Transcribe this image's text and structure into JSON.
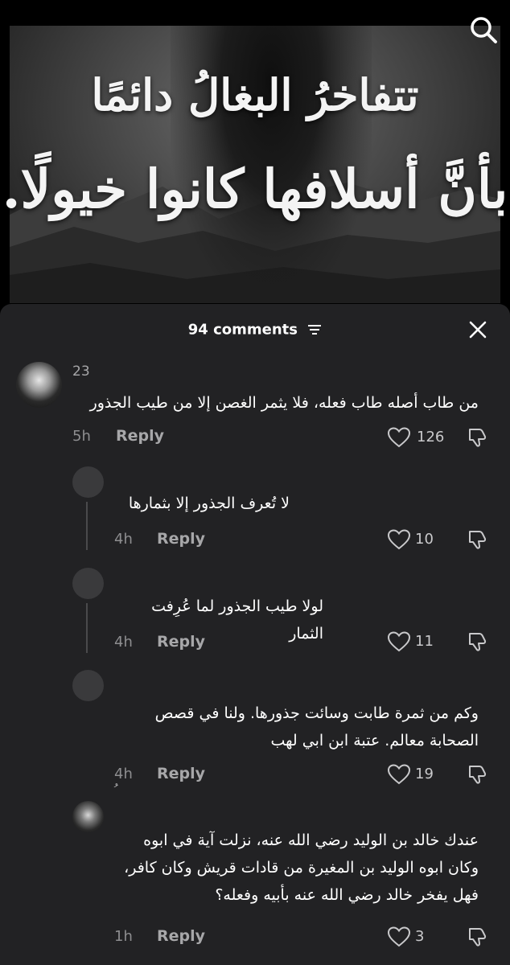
{
  "video": {
    "caption_line1": "تتفاخرُ البغالُ دائمًا",
    "caption_line2": "بأنَّ أسلافها كانوا خيولًا."
  },
  "comments_header": {
    "title": "94 comments"
  },
  "comments": [
    {
      "username": "23",
      "text": "من طاب أصله طاب فعله، فلا يثمر الغصن إلا من طيب الجذور",
      "time": "5h",
      "reply": "Reply",
      "likes": "126"
    },
    {
      "username": "",
      "text": "لا تُعرف الجذور إلا بثمارها",
      "time": "4h",
      "reply": "Reply",
      "likes": "10"
    },
    {
      "username": "",
      "text": "لولا طيب الجذور لما عُرِفت الثمار",
      "time": "4h",
      "reply": "Reply",
      "likes": "11"
    },
    {
      "username": "",
      "text": "وكم من ثمرة طابت وسائت جذورها. ولنا في قصص الصحابة معالم. عتبة ابن ابي لهب",
      "time": "4h",
      "reply": "Reply",
      "likes": "19"
    },
    {
      "username": "ُ",
      "text": "عندك خالد بن الوليد رضي الله عنه، نزلت آية في ابوه وكان ابوه الوليد بن المغيرة من قادات قريش وكان كافر، فهل يفخر خالد رضي الله عنه بأبيه وفعله؟",
      "time": "1h",
      "reply": "Reply",
      "likes": "3"
    }
  ]
}
